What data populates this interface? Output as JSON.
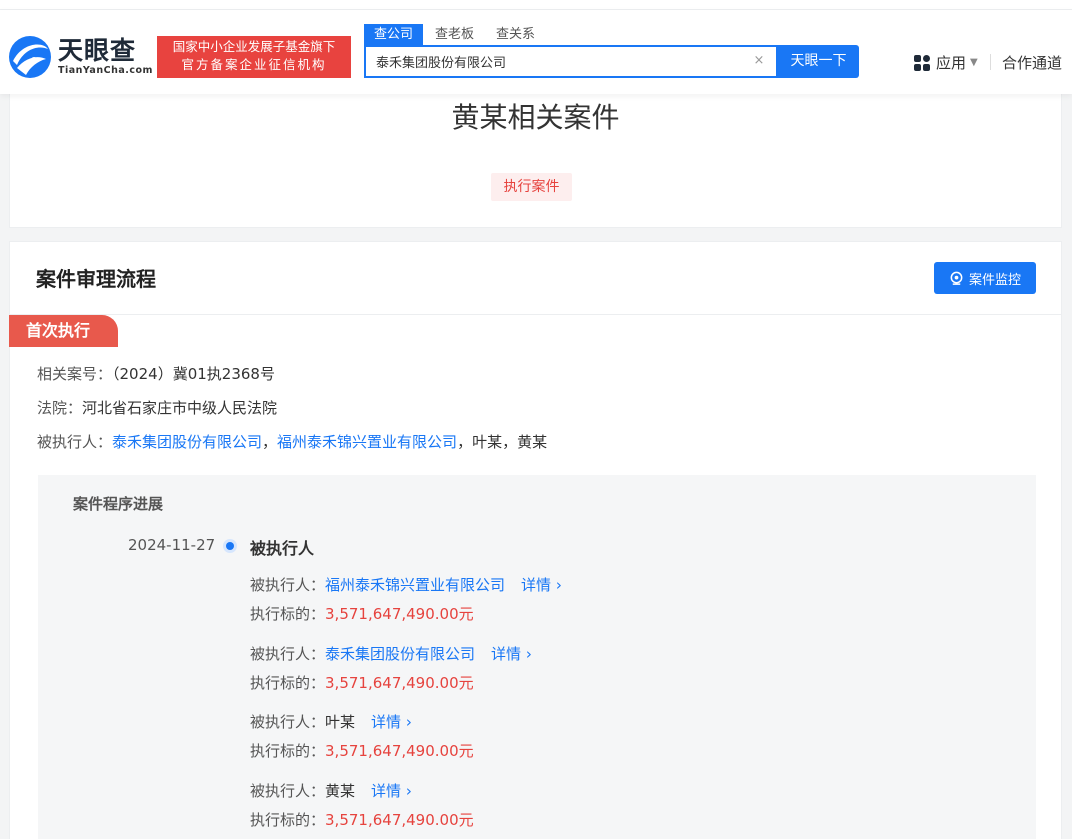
{
  "header": {
    "logo_cn": "天眼查",
    "logo_en": "TianYanCha.com",
    "badge_line1": "国家中小企业发展子基金旗下",
    "badge_line2": "官方备案企业征信机构",
    "search_tabs": [
      "查公司",
      "查老板",
      "查关系"
    ],
    "search_value": "泰禾集团股份有限公司",
    "clear_glyph": "×",
    "search_button": "天眼一下",
    "nav_apps": "应用",
    "nav_partner": "合作通道"
  },
  "case": {
    "title": "黄某相关案件",
    "tag": "执行案件"
  },
  "process": {
    "section_title": "案件审理流程",
    "monitor_button": "案件监控",
    "stage": "首次执行",
    "case_no_label": "相关案号：",
    "case_no": "（2024）冀01执2368号",
    "court_label": "法院：",
    "court": "河北省石家庄市中级人民法院",
    "executed_label": "被执行人：",
    "executed_1": "泰禾集团股份有限公司",
    "sep": "，",
    "executed_2": "福州泰禾锦兴置业有限公司",
    "executed_3": "叶某",
    "executed_4": "黄某",
    "progress_title": "案件程序进展",
    "timeline": {
      "date": "2024-11-27",
      "heading": "被执行人",
      "person_label": "被执行人：",
      "amount_label": "执行标的：",
      "detail": "详情",
      "entries": [
        {
          "name": "福州泰禾锦兴置业有限公司",
          "amount": "3,571,647,490.00元"
        },
        {
          "name": "泰禾集团股份有限公司",
          "amount": "3,571,647,490.00元"
        },
        {
          "name": "叶某",
          "amount": "3,571,647,490.00元"
        },
        {
          "name": "黄某",
          "amount": "3,571,647,490.00元"
        }
      ]
    }
  },
  "colors": {
    "primary": "#1977f5",
    "danger": "#e6433e",
    "stage": "#e8594c"
  }
}
